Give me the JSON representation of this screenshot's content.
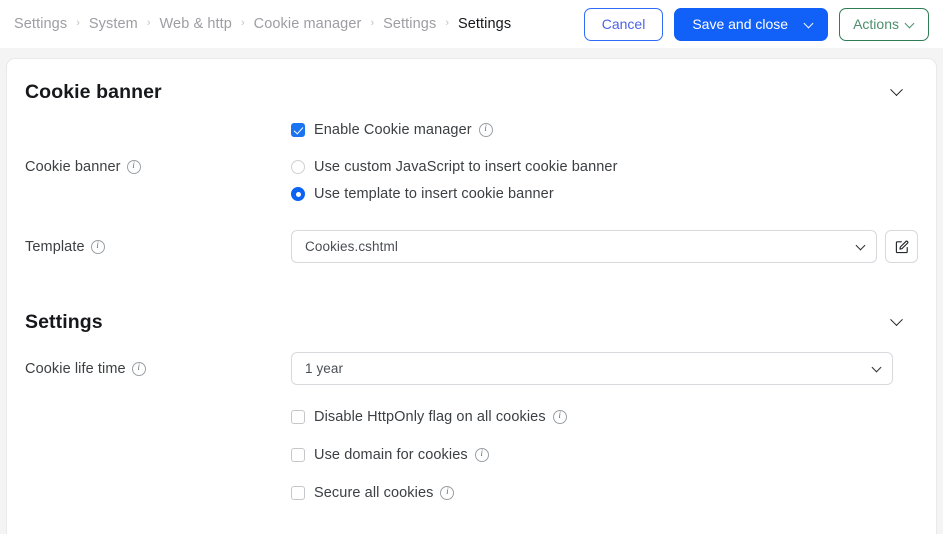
{
  "breadcrumb": {
    "separator": "›",
    "items": [
      {
        "label": "Settings",
        "current": false
      },
      {
        "label": "System",
        "current": false
      },
      {
        "label": "Web & http",
        "current": false
      },
      {
        "label": "Cookie manager",
        "current": false
      },
      {
        "label": "Settings",
        "current": false
      },
      {
        "label": "Settings",
        "current": true
      }
    ]
  },
  "toolbar": {
    "cancel_label": "Cancel",
    "save_label": "Save and close",
    "actions_label": "Actions",
    "cancel_color": "#4f63e8",
    "primary_color": "#1160f7",
    "actions_color": "#2e7d55"
  },
  "sections": [
    {
      "title": "Cookie banner",
      "collapse_icon": "chevron-down-icon"
    },
    {
      "title": "Settings",
      "collapse_icon": "chevron-down-icon"
    }
  ],
  "cookie_banner": {
    "enable": {
      "label": "Enable Cookie manager",
      "checked": true,
      "info_icon": "info-icon"
    },
    "banner_row": {
      "label": "Cookie banner",
      "info_icon": "info-icon",
      "options": [
        {
          "label": "Use custom JavaScript to insert cookie banner",
          "selected": false
        },
        {
          "label": "Use template to insert cookie banner",
          "selected": true
        }
      ]
    },
    "template_row": {
      "label": "Template",
      "info_icon": "info-icon",
      "value": "Cookies.cshtml",
      "caret_icon": "chevron-down-icon",
      "edit_icon": "edit-pencil-square-icon"
    }
  },
  "settings": {
    "cookie_life_time": {
      "label": "Cookie life time",
      "info_icon": "info-icon",
      "value": "1 year",
      "caret_icon": "chevron-down-icon"
    },
    "checkboxes": [
      {
        "label": "Disable HttpOnly flag on all cookies",
        "checked": false,
        "info_icon": "info-icon"
      },
      {
        "label": "Use domain for cookies",
        "checked": false,
        "info_icon": "info-icon"
      },
      {
        "label": "Secure all cookies",
        "checked": false,
        "info_icon": "info-icon"
      }
    ]
  }
}
